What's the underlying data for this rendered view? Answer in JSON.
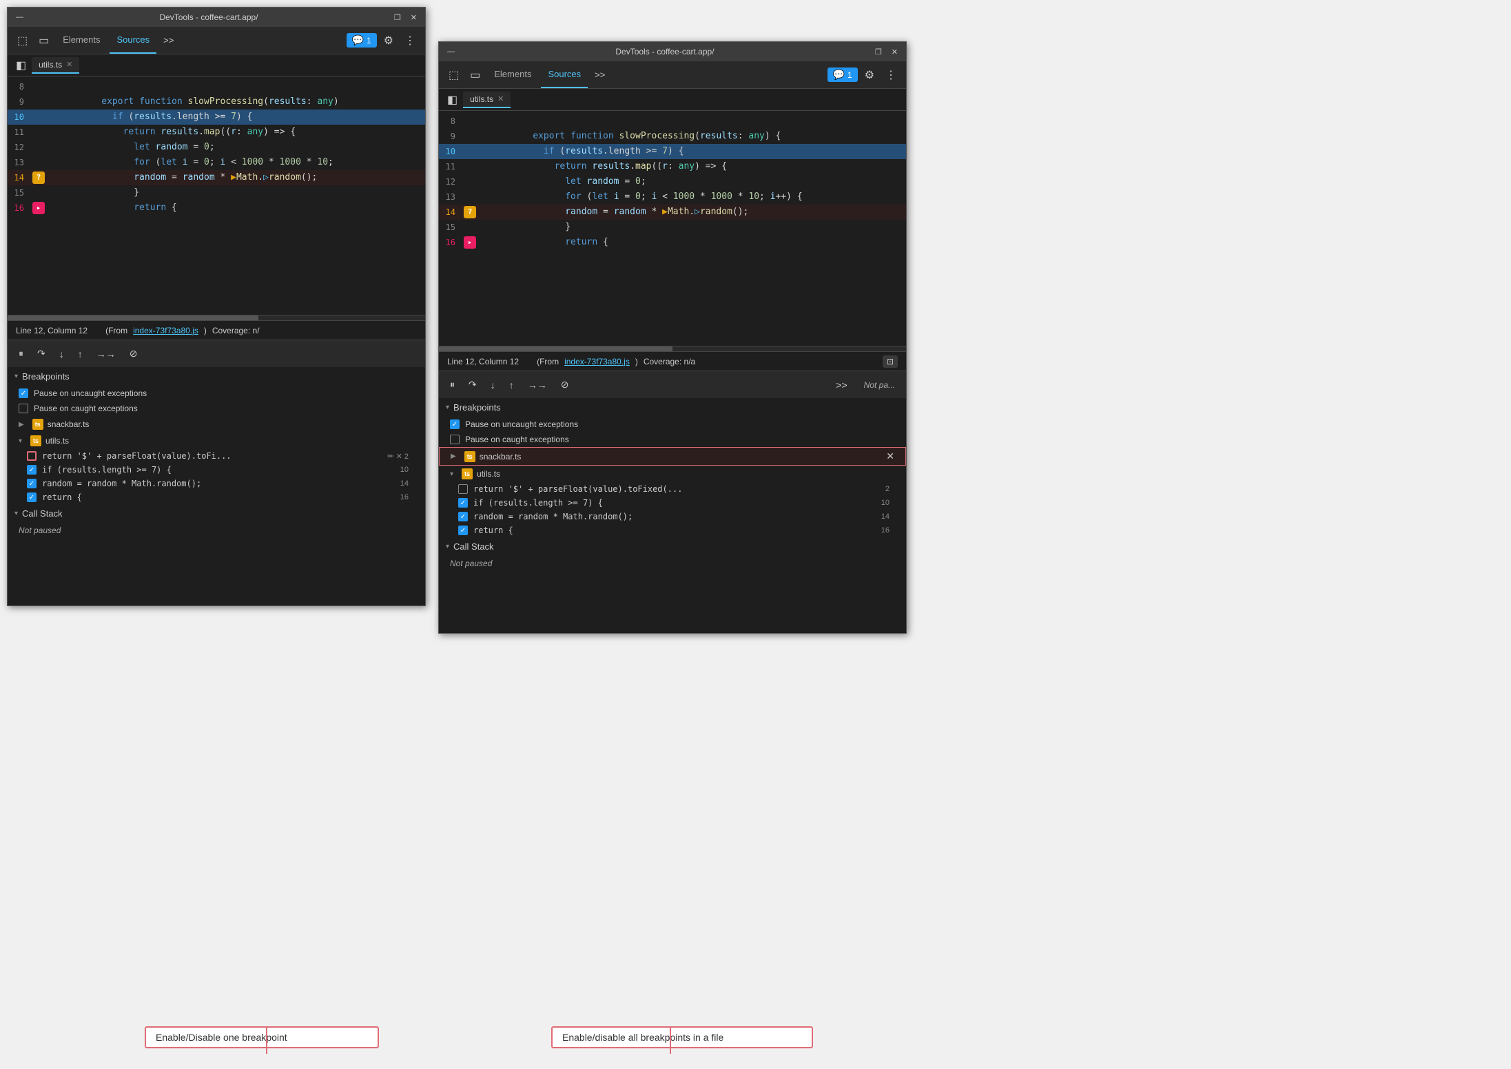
{
  "window1": {
    "title": "DevTools - coffee-cart.app/",
    "tabs": {
      "elements": "Elements",
      "sources": "Sources",
      "more": ">>"
    },
    "active_tab": "Sources",
    "message_badge": "1",
    "file_tab": "utils.ts",
    "code_lines": [
      {
        "num": "8",
        "type": "normal",
        "content": ""
      },
      {
        "num": "9",
        "type": "normal",
        "content": "export function slowProcessing(results: any)"
      },
      {
        "num": "10",
        "type": "highlighted",
        "content": "    if (results.length >= 7) {"
      },
      {
        "num": "11",
        "type": "normal",
        "content": "        return results.map((r: any) => {"
      },
      {
        "num": "12",
        "type": "normal",
        "content": "            let random = 0;"
      },
      {
        "num": "13",
        "type": "normal",
        "content": "            for (let i = 0; i < 1000 * 1000 * 10;"
      },
      {
        "num": "14",
        "type": "question",
        "content": "                random = random * ▶Math.▷random();"
      },
      {
        "num": "15",
        "type": "normal",
        "content": "            }"
      },
      {
        "num": "16",
        "type": "pink",
        "content": "            return {"
      }
    ],
    "statusbar": {
      "line_col": "Line 12, Column 12",
      "from_text": "(From",
      "from_link": "index-73f73a80.js",
      "coverage": "Coverage: n/"
    },
    "breakpoints": {
      "title": "Breakpoints",
      "pause_uncaught": "Pause on uncaught exceptions",
      "pause_caught": "Pause on caught exceptions",
      "files": [
        {
          "name": "snackbar.ts",
          "expanded": false
        },
        {
          "name": "utils.ts",
          "expanded": true,
          "items": [
            {
              "text": "return '$' + parseFloat(value).toFi...",
              "line": "",
              "edit": true,
              "checked": "outlined"
            },
            {
              "text": "if (results.length >= 7) {",
              "line": "10",
              "checked": "checked"
            },
            {
              "text": "random = random * Math.random();",
              "line": "14",
              "checked": "checked"
            },
            {
              "text": "return {",
              "line": "16",
              "checked": "checked"
            }
          ]
        }
      ]
    },
    "call_stack": {
      "title": "Call Stack",
      "content": "Not paused"
    }
  },
  "window2": {
    "title": "DevTools - coffee-cart.app/",
    "tabs": {
      "elements": "Elements",
      "sources": "Sources",
      "more": ">>"
    },
    "active_tab": "Sources",
    "message_badge": "1",
    "file_tab": "utils.ts",
    "code_lines": [
      {
        "num": "8",
        "type": "normal",
        "content": ""
      },
      {
        "num": "9",
        "type": "normal",
        "content": "export function slowProcessing(results: any) {"
      },
      {
        "num": "10",
        "type": "highlighted",
        "content": "    if (results.length >= 7) {"
      },
      {
        "num": "11",
        "type": "normal",
        "content": "        return results.map((r: any) => {"
      },
      {
        "num": "12",
        "type": "normal",
        "content": "            let random = 0;"
      },
      {
        "num": "13",
        "type": "normal",
        "content": "            for (let i = 0; i < 1000 * 1000 * 10; i++) {"
      },
      {
        "num": "14",
        "type": "question",
        "content": "                random = random * ▶Math.▷random();"
      },
      {
        "num": "15",
        "type": "normal",
        "content": "            }"
      },
      {
        "num": "16",
        "type": "pink",
        "content": "            return {"
      }
    ],
    "statusbar": {
      "line_col": "Line 12, Column 12",
      "from_text": "(From",
      "from_link": "index-73f73a80.js",
      "coverage": "Coverage: n/a"
    },
    "breakpoints": {
      "title": "Breakpoints",
      "pause_uncaught": "Pause on uncaught exceptions",
      "pause_caught": "Pause on caught exceptions",
      "files": [
        {
          "name": "snackbar.ts",
          "expanded": false,
          "highlighted": true
        },
        {
          "name": "utils.ts",
          "expanded": true,
          "items": [
            {
              "text": "return '$' + parseFloat(value).toFixed(...",
              "line": "2",
              "checked": "unchecked"
            },
            {
              "text": "if (results.length >= 7) {",
              "line": "10",
              "checked": "checked"
            },
            {
              "text": "random = random * Math.random();",
              "line": "14",
              "checked": "checked"
            },
            {
              "text": "return {",
              "line": "16",
              "checked": "checked"
            }
          ]
        }
      ]
    },
    "call_stack": {
      "title": "Call Stack",
      "content": "Not paused"
    }
  },
  "annotations": {
    "left": "Enable/Disable one breakpoint",
    "right": "Enable/disable all breakpoints in a file"
  },
  "icons": {
    "inspect": "⬚",
    "device": "⬜",
    "pause": "⏸",
    "step_over": "↷",
    "step_into": "↓",
    "step_out": "↑",
    "resume": "→→",
    "deactivate": "⊘",
    "chevron": "▾",
    "close": "×",
    "gear": "⚙",
    "menu": "⋮",
    "panel_left": "◧"
  }
}
